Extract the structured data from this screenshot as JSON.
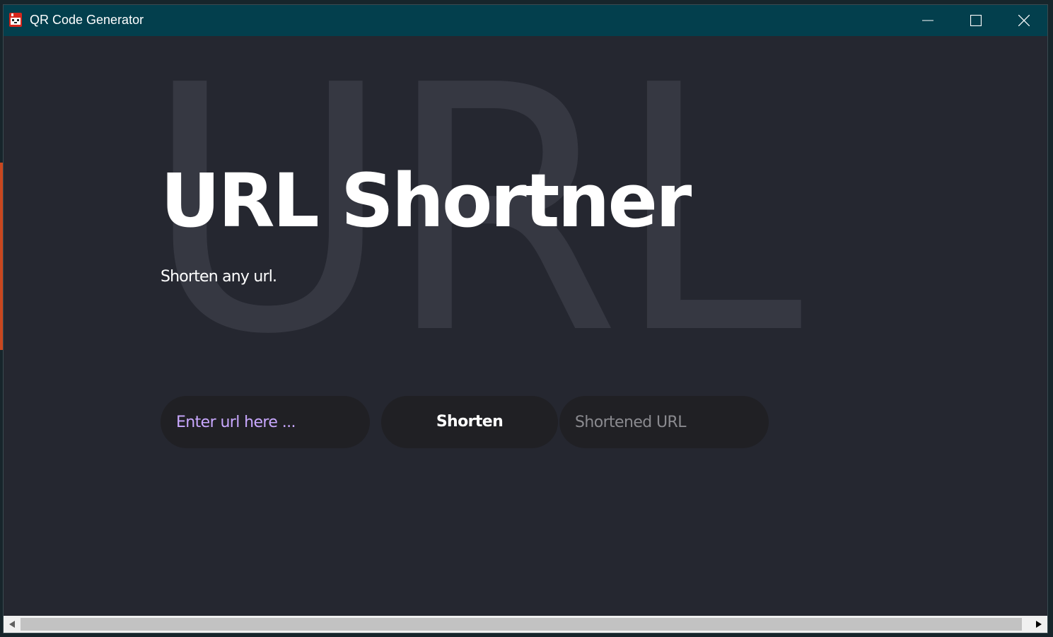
{
  "window": {
    "title": "QR Code Generator",
    "icon": "qr-app-icon"
  },
  "controls": {
    "minimize_icon": "minimize-icon",
    "maximize_icon": "maximize-icon",
    "close_icon": "close-icon"
  },
  "hero": {
    "background_word": "URL",
    "title": "URL Shortner",
    "subtitle": "Shorten any url."
  },
  "form": {
    "url_placeholder": "Enter url here ...",
    "url_value": "",
    "shorten_label": "Shorten",
    "result_placeholder": "Shortened URL",
    "result_value": ""
  },
  "scrollbar": {
    "left_icon": "scroll-left-arrow-icon",
    "right_icon": "scroll-right-arrow-icon"
  },
  "colors": {
    "titlebar": "#033f4d",
    "background": "#252730",
    "pill": "#202024",
    "placeholder_accent": "#c9a8ff"
  }
}
